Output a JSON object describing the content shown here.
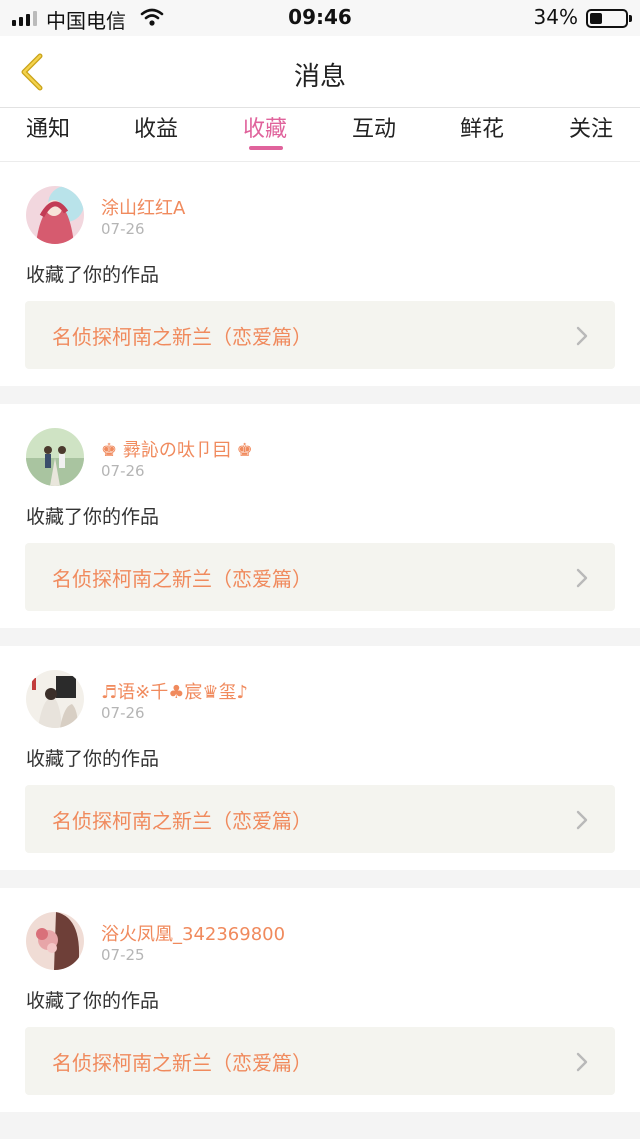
{
  "status_bar": {
    "carrier": "中国电信",
    "time": "09:46",
    "battery_percent": "34%",
    "battery_level": 0.34
  },
  "header": {
    "title": "消息",
    "back_icon": "chevron-left-icon"
  },
  "tabs": [
    {
      "label": "通知",
      "active": false
    },
    {
      "label": "收益",
      "active": false
    },
    {
      "label": "收藏",
      "active": true
    },
    {
      "label": "互动",
      "active": false
    },
    {
      "label": "鲜花",
      "active": false
    },
    {
      "label": "关注",
      "active": false
    }
  ],
  "colors": {
    "accent": "#e0639c",
    "username": "#f08a5d",
    "card_link_bg": "#f4f4ef"
  },
  "notifications": [
    {
      "username": "涂山红红A",
      "date": "07-26",
      "action": "收藏了你的作品",
      "work_title": "名侦探柯南之新兰（恋爱篇）"
    },
    {
      "username": "♚ 彛訫の呔卩囙 ♚",
      "date": "07-26",
      "action": "收藏了你的作品",
      "work_title": "名侦探柯南之新兰（恋爱篇）"
    },
    {
      "username": "♬语※千♣宸♛玺♪",
      "date": "07-26",
      "action": "收藏了你的作品",
      "work_title": "名侦探柯南之新兰（恋爱篇）"
    },
    {
      "username": "浴火凤凰_342369800",
      "date": "07-25",
      "action": "收藏了你的作品",
      "work_title": "名侦探柯南之新兰（恋爱篇）"
    }
  ]
}
